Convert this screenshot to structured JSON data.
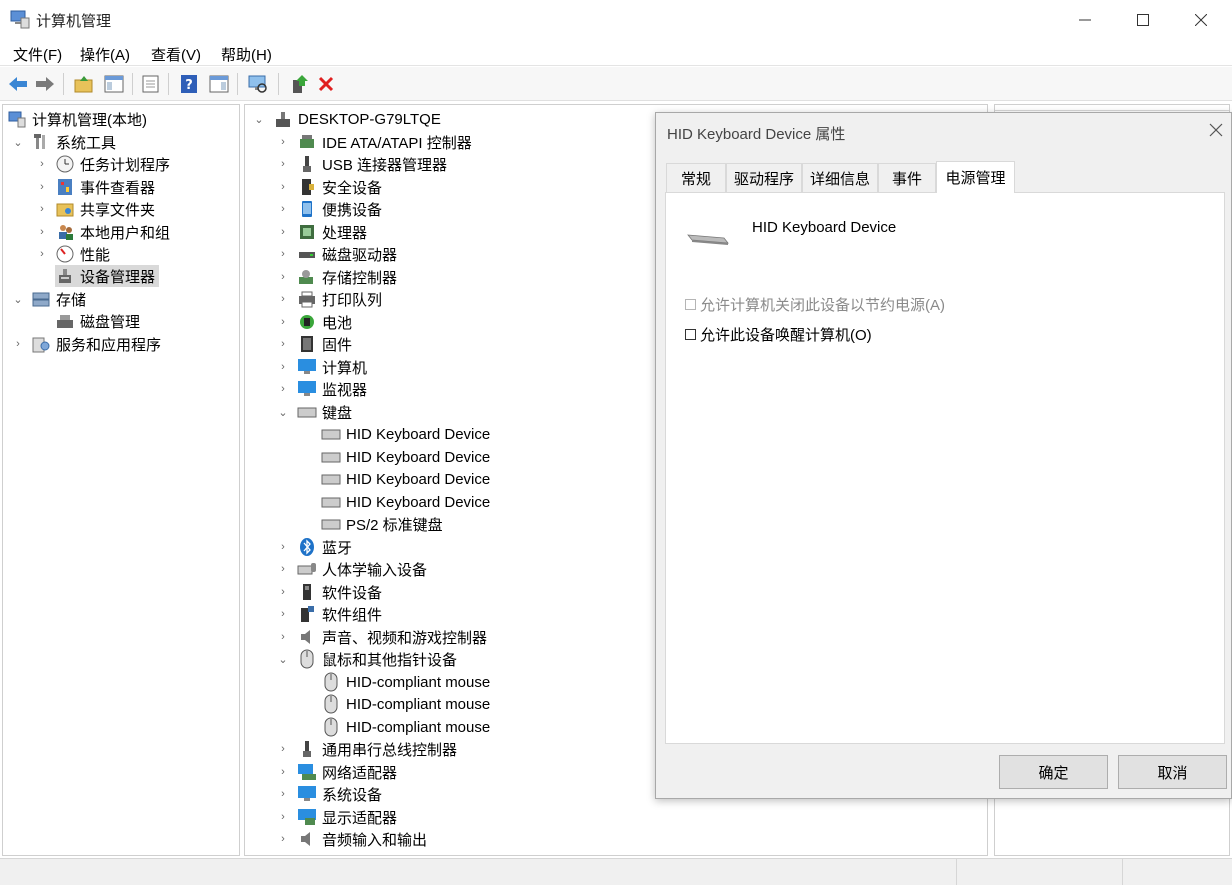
{
  "window": {
    "title": "计算机管理"
  },
  "menu": [
    "文件(F)",
    "操作(A)",
    "查看(V)",
    "帮助(H)"
  ],
  "left_tree": {
    "root": "计算机管理(本地)",
    "system_tools": "系统工具",
    "system_tools_children": [
      "任务计划程序",
      "事件查看器",
      "共享文件夹",
      "本地用户和组",
      "性能",
      "设备管理器"
    ],
    "storage": "存储",
    "storage_children": [
      "磁盘管理"
    ],
    "services": "服务和应用程序"
  },
  "device_tree": {
    "root": "DESKTOP-G79LTQE",
    "categories_top": [
      "IDE ATA/ATAPI 控制器",
      "USB 连接器管理器",
      "安全设备",
      "便携设备",
      "处理器",
      "磁盘驱动器",
      "存储控制器",
      "打印队列",
      "电池",
      "固件",
      "计算机",
      "监视器"
    ],
    "keyboard": "键盘",
    "keyboard_children": [
      "HID Keyboard Device",
      "HID Keyboard Device",
      "HID Keyboard Device",
      "HID Keyboard Device",
      "PS/2 标准键盘"
    ],
    "categories_mid": [
      "蓝牙",
      "人体学输入设备",
      "软件设备",
      "软件组件",
      "声音、视频和游戏控制器"
    ],
    "mouse": "鼠标和其他指针设备",
    "mouse_children": [
      "HID-compliant mouse",
      "HID-compliant mouse",
      "HID-compliant mouse"
    ],
    "categories_bottom": [
      "通用串行总线控制器",
      "网络适配器",
      "系统设备",
      "显示适配器",
      "音频输入和输出"
    ]
  },
  "dialog": {
    "title": "HID Keyboard Device 属性",
    "tabs": [
      "常规",
      "驱动程序",
      "详细信息",
      "事件",
      "电源管理"
    ],
    "active_tab": "电源管理",
    "device_name": "HID Keyboard Device",
    "options": [
      {
        "label": "允许计算机关闭此设备以节约电源(A)",
        "checked": false,
        "disabled": true
      },
      {
        "label": "允许此设备唤醒计算机(O)",
        "checked": false,
        "disabled": false
      }
    ],
    "ok": "确定",
    "cancel": "取消"
  },
  "colors": {
    "accent_blue": "#1e72c8",
    "delete_red": "#e02020",
    "selection": "#d9d9d9"
  }
}
